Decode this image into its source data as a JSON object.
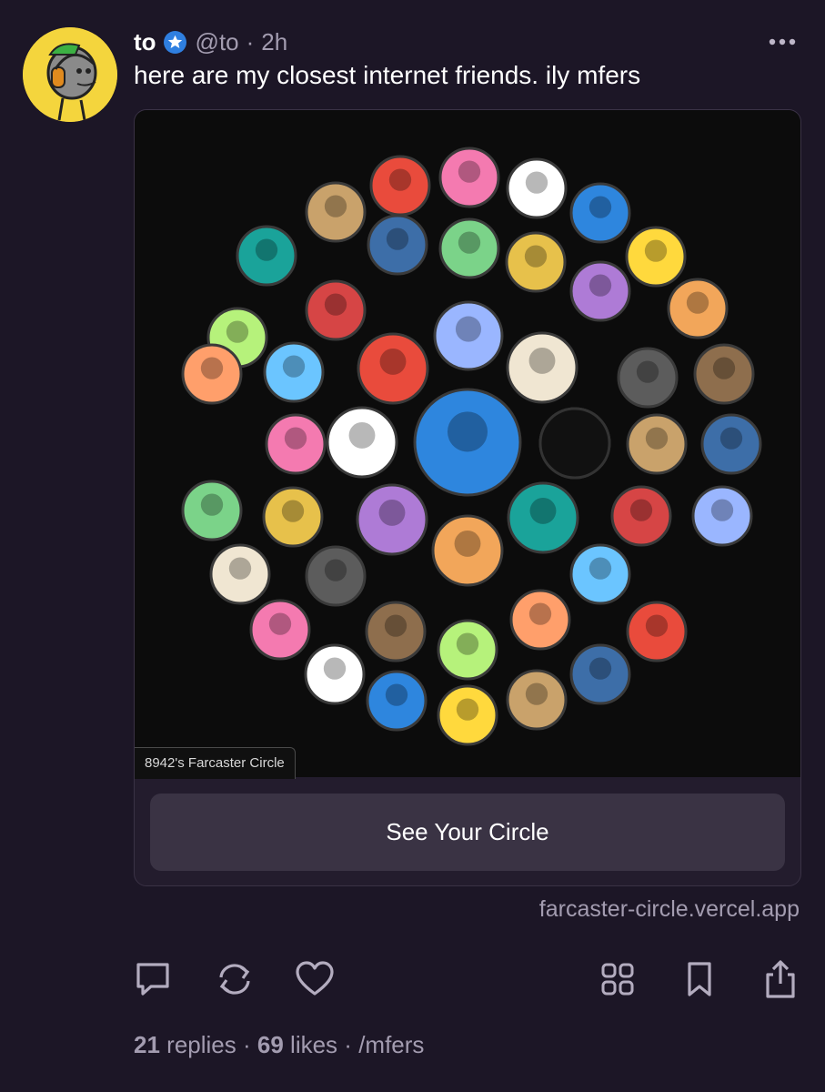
{
  "post": {
    "display_name": "to",
    "handle": "@to",
    "separator": "·",
    "time": "2h",
    "text": "here are my closest internet friends. ily mfers",
    "verified_icon": "verified-star-icon",
    "more_icon": "ellipsis-icon"
  },
  "embed": {
    "caption": "8942's Farcaster Circle",
    "button_label": "See Your Circle",
    "domain": "farcaster-circle.vercel.app",
    "colors": {
      "palette": [
        "#e94b3c",
        "#f47ab0",
        "#ffffff",
        "#2e86de",
        "#ffd93d",
        "#c9a26b",
        "#3d6ea8",
        "#7bd389",
        "#e7c14b",
        "#ae7bd6",
        "#f2a65a",
        "#1aa39a",
        "#d64545",
        "#9ab6ff",
        "#f0e6d2",
        "#5c5c5c",
        "#8e6e4d",
        "#b6f27b",
        "#ff9f6b",
        "#6bc5ff"
      ]
    }
  },
  "actions": {
    "reply_icon": "comment-icon",
    "recast_icon": "recast-icon",
    "like_icon": "heart-icon",
    "grid_icon": "grid-icon",
    "bookmark_icon": "bookmark-icon",
    "share_icon": "share-icon"
  },
  "stats": {
    "replies_count": "21",
    "replies_label": "replies",
    "sep1": "·",
    "likes_count": "69",
    "likes_label": "likes",
    "sep2": "·",
    "channel": "/mfers"
  }
}
